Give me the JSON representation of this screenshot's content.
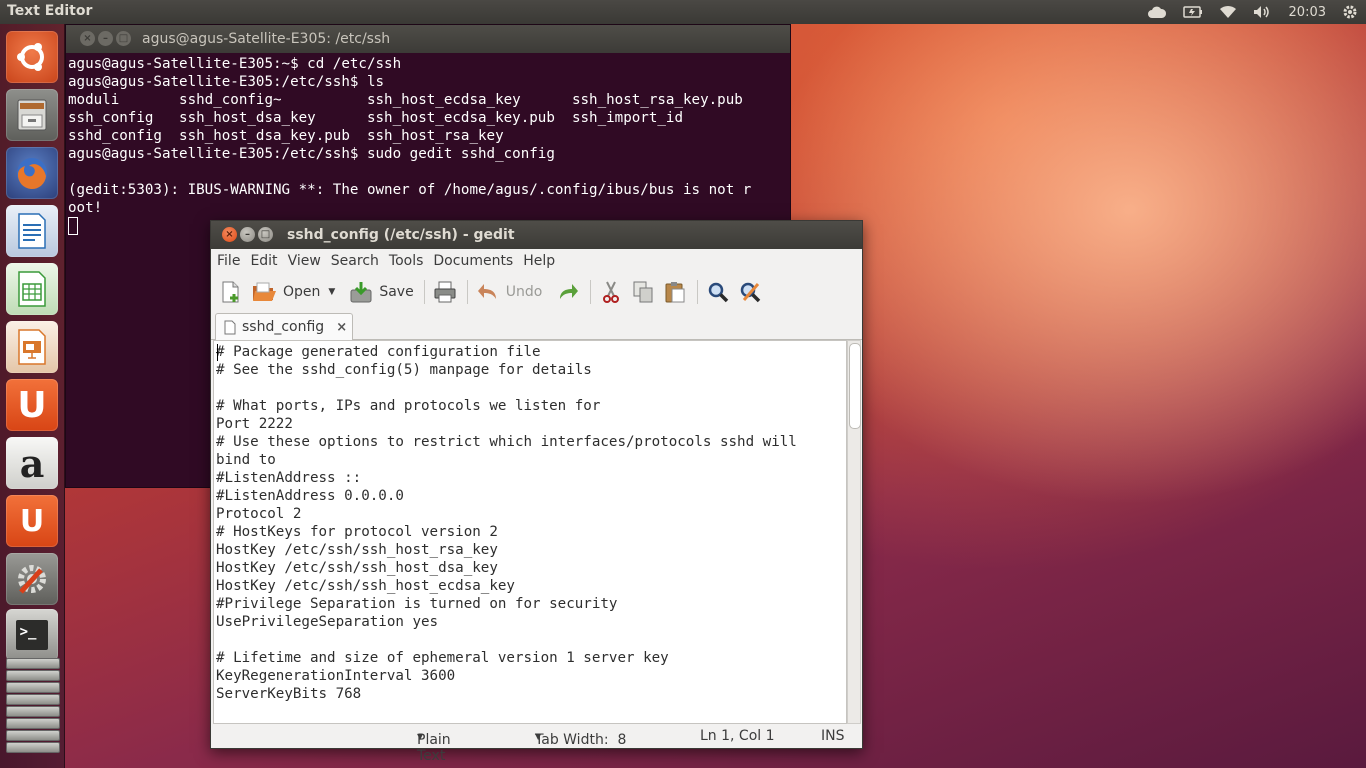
{
  "top_panel": {
    "app_title": "Text Editor",
    "clock": "20:03",
    "tray_icons": [
      "cloud-icon",
      "battery-icon",
      "wifi-icon",
      "volume-icon",
      "gear-icon"
    ]
  },
  "launcher": {
    "items": [
      {
        "name": "ubuntu-dash",
        "icon": "ubuntu-logo-icon"
      },
      {
        "name": "files",
        "icon": "file-cabinet-icon"
      },
      {
        "name": "firefox",
        "icon": "firefox-icon"
      },
      {
        "name": "libreoffice-writer",
        "icon": "writer-icon"
      },
      {
        "name": "libreoffice-calc",
        "icon": "calc-icon"
      },
      {
        "name": "libreoffice-impress",
        "icon": "impress-icon"
      },
      {
        "name": "ubuntu-software",
        "icon": "software-center-icon",
        "glyph": "U"
      },
      {
        "name": "amazon",
        "icon": "amazon-icon",
        "glyph": "a"
      },
      {
        "name": "ubuntu-one-music",
        "icon": "music-icon",
        "glyph": "U"
      },
      {
        "name": "system-settings",
        "icon": "settings-icon"
      },
      {
        "name": "terminal",
        "icon": "terminal-icon",
        "glyph": ">_"
      }
    ],
    "colors": {
      "orange": "#e0531e",
      "firefox": "#e8772a",
      "writer": "#2a6fb5",
      "calc": "#3a9a3a",
      "impress": "#d9772b"
    }
  },
  "terminal": {
    "title": "agus@agus-Satellite-E305: /etc/ssh",
    "lines": [
      "agus@agus-Satellite-E305:~$ cd /etc/ssh",
      "agus@agus-Satellite-E305:/etc/ssh$ ls",
      "moduli       sshd_config~          ssh_host_ecdsa_key      ssh_host_rsa_key.pub",
      "ssh_config   ssh_host_dsa_key      ssh_host_ecdsa_key.pub  ssh_import_id",
      "sshd_config  ssh_host_dsa_key.pub  ssh_host_rsa_key",
      "agus@agus-Satellite-E305:/etc/ssh$ sudo gedit sshd_config",
      "",
      "(gedit:5303): IBUS-WARNING **: The owner of /home/agus/.config/ibus/bus is not r",
      "oot!"
    ],
    "background": "#300a24"
  },
  "gedit": {
    "title": "sshd_config (/etc/ssh) - gedit",
    "menu": [
      "File",
      "Edit",
      "View",
      "Search",
      "Tools",
      "Documents",
      "Help"
    ],
    "toolbar": {
      "open_label": "Open",
      "save_label": "Save",
      "undo_label": "Undo"
    },
    "tab": {
      "label": "sshd_config",
      "close": "×"
    },
    "lines": [
      "# Package generated configuration file",
      "# See the sshd_config(5) manpage for details",
      "",
      "# What ports, IPs and protocols we listen for",
      "Port 2222",
      "# Use these options to restrict which interfaces/protocols sshd will",
      "bind to",
      "#ListenAddress ::",
      "#ListenAddress 0.0.0.0",
      "Protocol 2",
      "# HostKeys for protocol version 2",
      "HostKey /etc/ssh/ssh_host_rsa_key",
      "HostKey /etc/ssh/ssh_host_dsa_key",
      "HostKey /etc/ssh/ssh_host_ecdsa_key",
      "#Privilege Separation is turned on for security",
      "UsePrivilegeSeparation yes",
      "",
      "# Lifetime and size of ephemeral version 1 server key",
      "KeyRegenerationInterval 3600",
      "ServerKeyBits 768"
    ],
    "status": {
      "language": "Plain Text",
      "tab_width": "Tab Width:  8",
      "position": "Ln 1, Col 1",
      "mode": "INS"
    }
  }
}
